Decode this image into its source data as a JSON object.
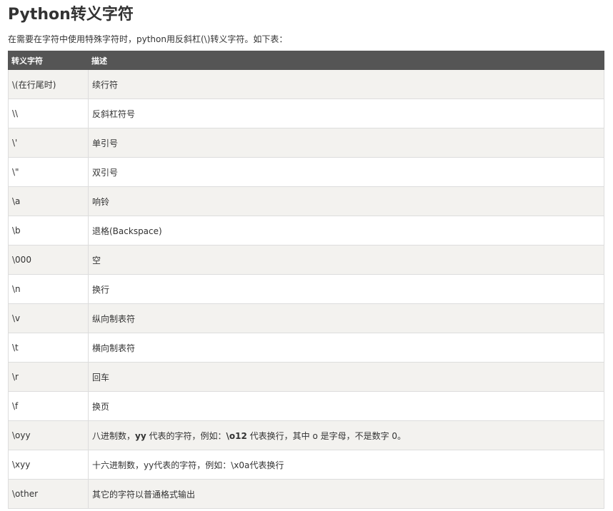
{
  "page": {
    "title": "Python转义字符",
    "intro": "在需要在字符中使用特殊字符时，python用反斜杠(\\)转义字符。如下表："
  },
  "table": {
    "headers": [
      "转义字符",
      "描述"
    ],
    "rows": [
      {
        "escape": "\\(在行尾时)",
        "description": "续行符"
      },
      {
        "escape": "\\\\",
        "description": "反斜杠符号"
      },
      {
        "escape": "\\'",
        "description": "单引号"
      },
      {
        "escape": "\\\"",
        "description": "双引号"
      },
      {
        "escape": "\\a",
        "description": "响铃"
      },
      {
        "escape": "\\b",
        "description": "退格(Backspace)"
      },
      {
        "escape": "\\000",
        "description": "空"
      },
      {
        "escape": "\\n",
        "description": "换行"
      },
      {
        "escape": "\\v",
        "description": "纵向制表符"
      },
      {
        "escape": "\\t",
        "description": "横向制表符"
      },
      {
        "escape": "\\r",
        "description": "回车"
      },
      {
        "escape": "\\f",
        "description": "换页"
      },
      {
        "escape": "\\oyy",
        "description_parts": [
          "八进制数，",
          "yy",
          " 代表的字符，例如：",
          "\\o12",
          " 代表换行，其中 o 是字母，不是数字 0。"
        ]
      },
      {
        "escape": "\\xyy",
        "description": "十六进制数，yy代表的字符，例如：\\x0a代表换行"
      },
      {
        "escape": "\\other",
        "description": "其它的字符以普通格式输出"
      }
    ]
  }
}
